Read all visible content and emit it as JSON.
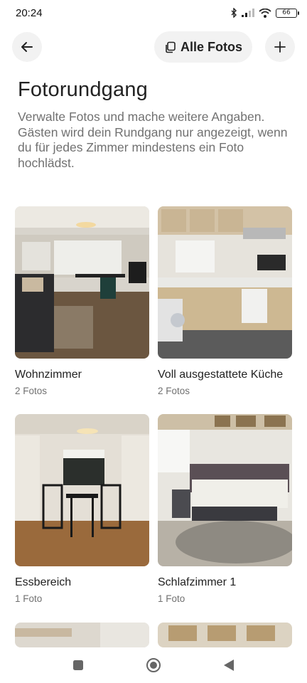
{
  "status_bar": {
    "time": "20:24",
    "battery": "66"
  },
  "header": {
    "back_icon": "arrow-left-icon",
    "all_photos_label": "Alle Fotos",
    "all_photos_icon": "copy-icon",
    "add_icon": "plus-icon"
  },
  "page": {
    "title": "Fotorundgang",
    "description": "Verwalte Fotos und mache weitere Angaben. Gästen wird dein Rundgang nur angezeigt, wenn du für jedes Zimmer mindestens ein Foto hochlädst."
  },
  "rooms": [
    {
      "name": "Wohnzimmer",
      "count": "2 Fotos"
    },
    {
      "name": "Voll ausgestattete Küche",
      "count": "2 Fotos"
    },
    {
      "name": "Essbereich",
      "count": "1 Foto"
    },
    {
      "name": "Schlafzimmer 1",
      "count": "1 Foto"
    }
  ],
  "nav": {
    "recents_icon": "square-icon",
    "home_icon": "circle-home-icon",
    "back_icon": "triangle-back-icon"
  },
  "colors": {
    "text": "#222222",
    "muted": "#717171",
    "button_bg": "#f2f2f2"
  }
}
